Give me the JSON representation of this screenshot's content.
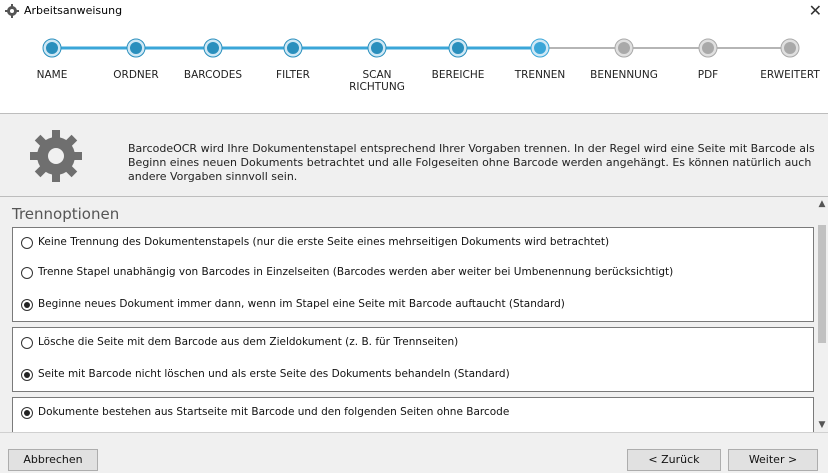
{
  "window": {
    "title": "Arbeitsanweisung",
    "app_icon": "gear-icon",
    "close_icon": "close-icon"
  },
  "wizard": {
    "steps": [
      {
        "label": "NAME",
        "state": "done"
      },
      {
        "label": "ORDNER",
        "state": "done"
      },
      {
        "label": "BARCODES",
        "state": "done"
      },
      {
        "label": "FILTER",
        "state": "done"
      },
      {
        "label": "SCAN\nRICHTUNG",
        "state": "done"
      },
      {
        "label": "BEREICHE",
        "state": "done"
      },
      {
        "label": "TRENNEN",
        "state": "current"
      },
      {
        "label": "BENENNUNG",
        "state": "pending"
      },
      {
        "label": "PDF",
        "state": "pending"
      },
      {
        "label": "ERWEITERT",
        "state": "pending"
      }
    ],
    "colors": {
      "done": "#2a8fbd",
      "current": "#3aa6d8",
      "pending": "#a9a9a9",
      "line_done": "#3aa6d8",
      "line_pending": "#b5b5b5"
    }
  },
  "info": {
    "icon": "gear-icon",
    "text": "BarcodeOCR wird Ihre Dokumentenstapel entsprechend Ihrer Vorgaben trennen. In der Regel wird eine Seite mit Barcode als Beginn eines neuen Dokuments betrachtet und alle Folgeseiten ohne Barcode werden angehängt. Es können natürlich auch andere Vorgaben sinnvoll sein."
  },
  "section": {
    "title": "Trennoptionen"
  },
  "group1": {
    "options": [
      {
        "label": "Keine Trennung des Dokumentenstapels (nur die erste Seite eines mehrseitigen Dokuments wird betrachtet)",
        "selected": false
      },
      {
        "label": "Trenne Stapel unabhängig von Barcodes in Einzelseiten (Barcodes werden aber weiter bei Umbenennung berücksichtigt)",
        "selected": false
      },
      {
        "label": "Beginne neues Dokument immer dann, wenn im Stapel eine Seite mit Barcode auftaucht (Standard)",
        "selected": true
      }
    ]
  },
  "group2": {
    "options": [
      {
        "label": "Lösche die Seite mit dem Barcode aus dem Zieldokument (z. B. für Trennseiten)",
        "selected": false
      },
      {
        "label": "Seite mit Barcode nicht löschen und als erste Seite des Dokuments behandeln (Standard)",
        "selected": true
      }
    ]
  },
  "group3": {
    "options": [
      {
        "label": "Dokumente bestehen aus Startseite mit Barcode und den folgenden Seiten ohne Barcode",
        "selected": true
      }
    ]
  },
  "footer": {
    "cancel_label": "Abbrechen",
    "back_label": "< Zurück",
    "next_label": "Weiter >"
  }
}
